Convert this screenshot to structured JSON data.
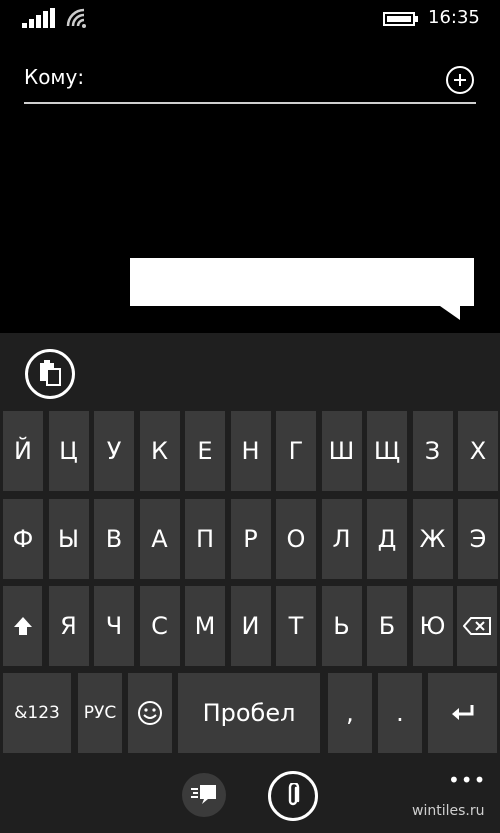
{
  "status_bar": {
    "time": "16:35",
    "icons": [
      "signal-icon",
      "wifi-icon",
      "battery-icon"
    ]
  },
  "compose": {
    "to_label": "Кому:",
    "to_value": "",
    "add_icon": "plus-circle-icon"
  },
  "clipboard_icon": "clipboard-icon",
  "keyboard": {
    "row1": [
      "Й",
      "Ц",
      "У",
      "К",
      "Е",
      "Н",
      "Г",
      "Ш",
      "Щ",
      "З",
      "Х"
    ],
    "row2": [
      "Ф",
      "Ы",
      "В",
      "А",
      "П",
      "Р",
      "О",
      "Л",
      "Д",
      "Ж",
      "Э"
    ],
    "row3": [
      "Я",
      "Ч",
      "С",
      "М",
      "И",
      "Т",
      "Ь",
      "Б",
      "Ю"
    ],
    "shift_icon": "shift-arrow-icon",
    "backspace_icon": "backspace-icon",
    "row4": {
      "symbols": "&123",
      "language": "РУС",
      "emoji_icon": "smiley-icon",
      "space": "Пробел",
      "comma": ",",
      "period": ".",
      "enter_icon": "enter-arrow-icon"
    }
  },
  "app_bar": {
    "buttons": [
      "chat-switch-icon",
      "attach-icon"
    ],
    "more": "•••"
  },
  "watermark": "wintiles.ru"
}
